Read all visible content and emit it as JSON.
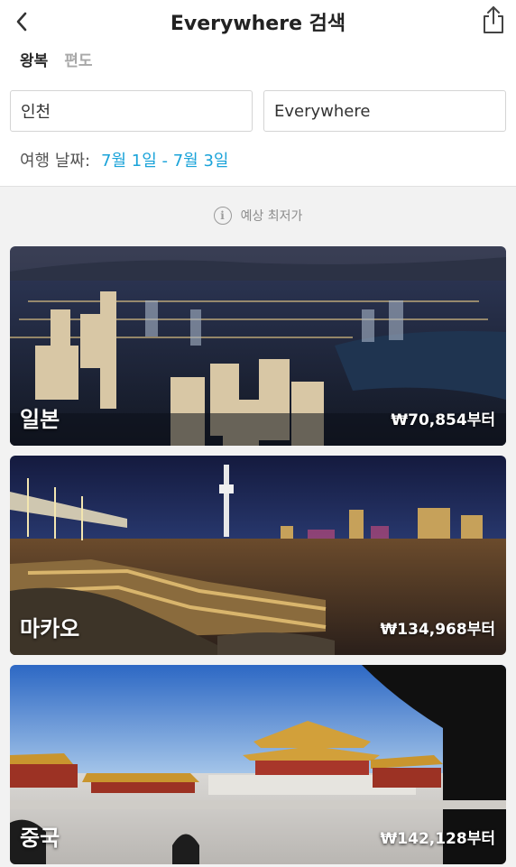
{
  "header": {
    "title": "Everywhere 검색",
    "back_icon": "chevron-left-icon",
    "share_icon": "share-icon"
  },
  "trip_type": {
    "tabs": [
      {
        "label": "왕복",
        "active": true
      },
      {
        "label": "편도",
        "active": false
      }
    ]
  },
  "search": {
    "origin": "인천",
    "destination": "Everywhere"
  },
  "dates": {
    "label": "여행 날짜:",
    "value": "7월 1일 - 7월 3일"
  },
  "notice": {
    "text": "예상 최저가",
    "icon": "info-icon"
  },
  "destinations": [
    {
      "name": "일본",
      "price": "₩70,854부터"
    },
    {
      "name": "마카오",
      "price": "₩134,968부터"
    },
    {
      "name": "중국",
      "price": "₩142,128부터"
    }
  ],
  "colors": {
    "accent": "#1aa3d9",
    "background": "#f2f2f2"
  }
}
